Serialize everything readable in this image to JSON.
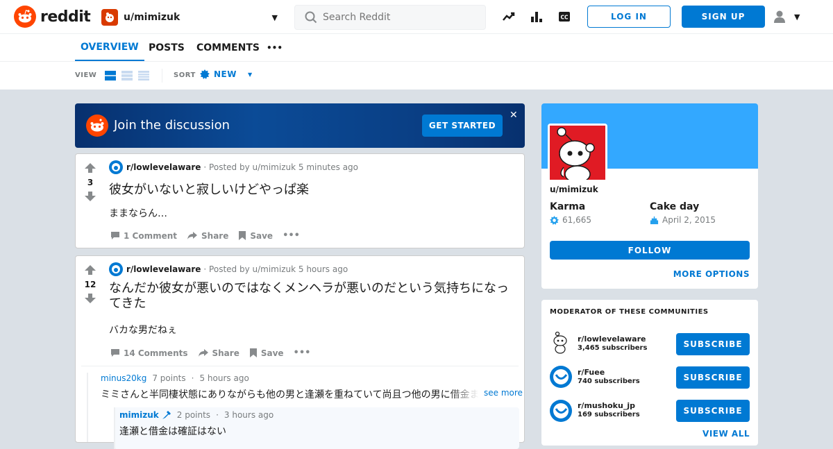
{
  "header": {
    "logo_text": "reddit",
    "user_dropdown": "u/mimizuk",
    "search_placeholder": "Search Reddit",
    "login_label": "LOG IN",
    "signup_label": "SIGN UP"
  },
  "tabs": [
    "OVERVIEW",
    "POSTS",
    "COMMENTS",
    "•••"
  ],
  "viewbar": {
    "view_label": "VIEW",
    "sort_label": "SORT",
    "sort_value": "NEW"
  },
  "banner": {
    "text": "Join the discussion",
    "cta": "GET STARTED",
    "close": "✕"
  },
  "posts": [
    {
      "votes": "3",
      "subreddit": "r/lowlevelaware",
      "posted_by": "· Posted by u/mimizuk 5 minutes ago",
      "title": "彼女がいないと寂しいけどやっぱ楽",
      "body": "ままならん…",
      "comments_label": "1 Comment",
      "share_label": "Share",
      "save_label": "Save"
    },
    {
      "votes": "12",
      "subreddit": "r/lowlevelaware",
      "posted_by": "· Posted by u/mimizuk 5 hours ago",
      "title": "なんだか彼女が悪いのではなくメンヘラが悪いのだという気持ちになってきた",
      "body": "バカな男だねぇ",
      "comments_label": "14 Comments",
      "share_label": "Share",
      "save_label": "Save"
    }
  ],
  "comments": [
    {
      "author": "minus20kg",
      "points": "7 points",
      "time": "5 hours ago",
      "text": "ミミさんと半同棲状態にありながらも他の男と逢瀬を重ねていて尚且つ他の男に借金まで",
      "see_more": "see more"
    },
    {
      "author": "mimizuk",
      "points": "2 points",
      "time": "3 hours ago",
      "text": "逢瀬と借金は確証はない"
    }
  ],
  "profile": {
    "username": "u/mimizuk",
    "karma_label": "Karma",
    "karma_value": "61,665",
    "cakeday_label": "Cake day",
    "cakeday_value": "April 2, 2015",
    "follow_label": "FOLLOW",
    "more_options": "MORE OPTIONS"
  },
  "moderator": {
    "title": "MODERATOR OF THESE COMMUNITIES",
    "communities": [
      {
        "name": "r/lowlevelaware",
        "subs": "3,465 subscribers",
        "btn": "SUBSCRIBE"
      },
      {
        "name": "r/Fuee",
        "subs": "740 subscribers",
        "btn": "SUBSCRIBE"
      },
      {
        "name": "r/mushoku_jp",
        "subs": "169 subscribers",
        "btn": "SUBSCRIBE"
      }
    ],
    "view_all": "VIEW ALL"
  },
  "colors": {
    "accent": "#0079d3",
    "reddit_orange": "#ff4500",
    "profile_banner": "#33a8ff"
  }
}
